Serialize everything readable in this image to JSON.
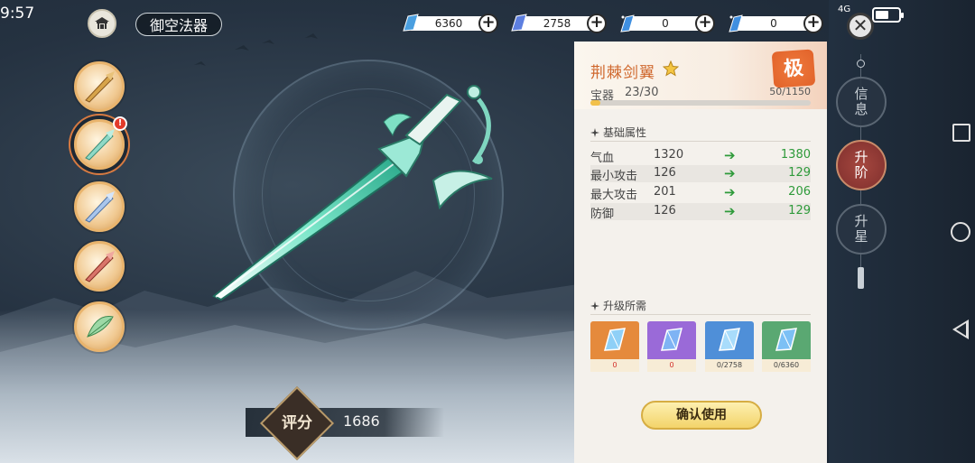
{
  "status_bar": {
    "time": "9:57",
    "network": "4G",
    "battery_level": 0.6
  },
  "header": {
    "title": "御空法器"
  },
  "currencies": [
    {
      "name": "blue-crystal",
      "value": "6360",
      "color": "#4a9fe0"
    },
    {
      "name": "purple-crystal",
      "value": "2758",
      "color": "#5d7fe0"
    },
    {
      "name": "spark-crystal-1",
      "value": "0",
      "color": "#3f8fe0"
    },
    {
      "name": "spark-crystal-2",
      "value": "0",
      "color": "#3f8fe0"
    }
  ],
  "weapon_list": [
    {
      "name": "golden-sword",
      "selected": false,
      "badge": ""
    },
    {
      "name": "jade-sword",
      "selected": true,
      "badge": "!"
    },
    {
      "name": "ice-sword",
      "selected": false,
      "badge": ""
    },
    {
      "name": "crimson-sword",
      "selected": false,
      "badge": ""
    },
    {
      "name": "green-fan",
      "selected": false,
      "badge": ""
    }
  ],
  "score": {
    "label": "评分",
    "value": "1686"
  },
  "panel": {
    "name": "荆棘剑翼",
    "rank": "极",
    "level_label": "宝器",
    "level": "23/30",
    "exp_text": "50/1150",
    "exp_fraction": 0.0435,
    "base_attr_title": "基础属性",
    "attributes": [
      {
        "name": "气血",
        "current": "1320",
        "next": "1380"
      },
      {
        "name": "最小攻击",
        "current": "126",
        "next": "129"
      },
      {
        "name": "最大攻击",
        "current": "201",
        "next": "206"
      },
      {
        "name": "防御",
        "current": "126",
        "next": "129"
      }
    ],
    "materials_title": "升级所需",
    "materials": [
      {
        "name": "orange-crystal",
        "count": "0",
        "bg": "#e58a3c",
        "insufficient": true
      },
      {
        "name": "purple-crystal",
        "count": "0",
        "bg": "#9a6ad8",
        "insufficient": true
      },
      {
        "name": "blue-crystal",
        "count": "0/2758",
        "bg": "#4f8fd8",
        "insufficient": false
      },
      {
        "name": "green-crystal",
        "count": "0/6360",
        "bg": "#5aa872",
        "insufficient": false
      }
    ],
    "confirm_label": "确认使用"
  },
  "side_tabs": [
    {
      "name": "info",
      "label_top": "信",
      "label_bottom": "息",
      "active": false
    },
    {
      "name": "upgrade",
      "label_top": "升",
      "label_bottom": "阶",
      "active": true
    },
    {
      "name": "star",
      "label_top": "升",
      "label_bottom": "星",
      "active": false
    }
  ],
  "colors": {
    "accent_green": "#2e9a3a",
    "title_orange": "#d0692f",
    "exp_yellow": "#f2c14b"
  }
}
